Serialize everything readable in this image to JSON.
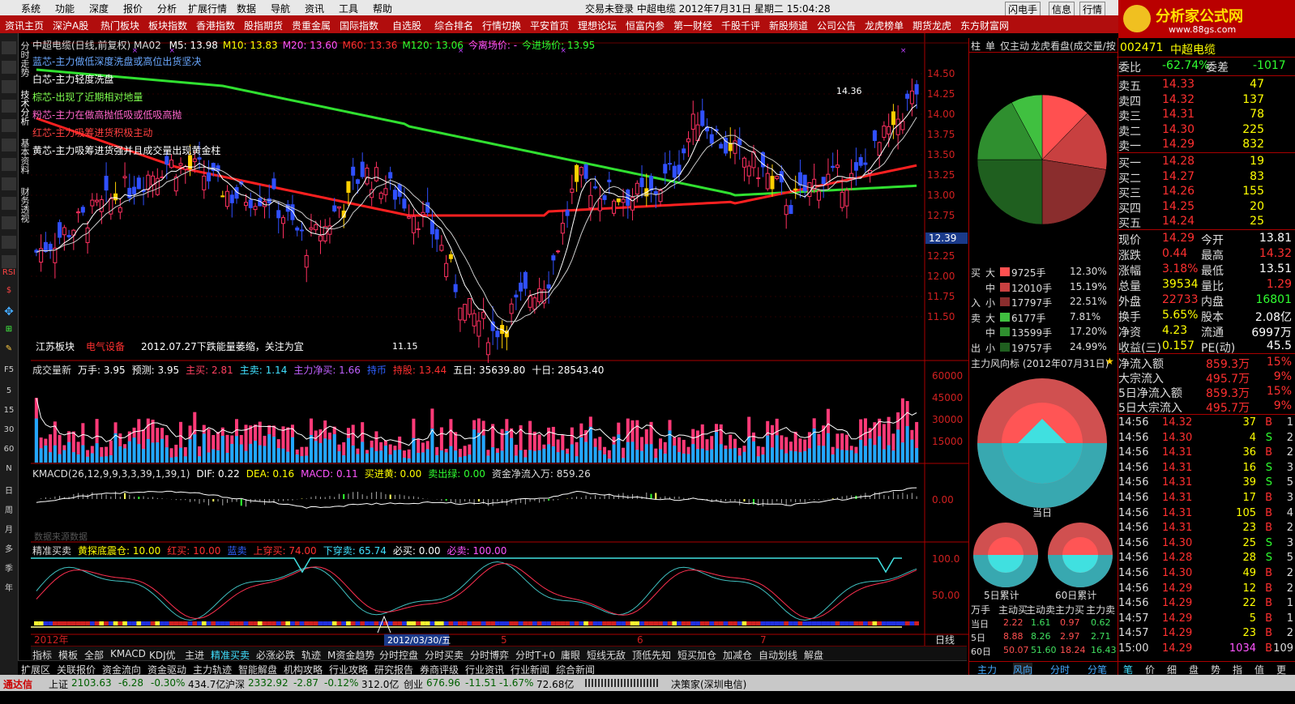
{
  "menubar": {
    "items": [
      "系统",
      "功能",
      "深度",
      "报价",
      "分析",
      "扩展行情",
      "数据",
      "导航",
      "资讯",
      "工具",
      "帮助"
    ],
    "center": "交易未登录   中超电缆  2012年7月31日  星期二  15:04:28",
    "right_buttons": [
      "闪电手",
      "信息",
      "行情"
    ]
  },
  "brand": {
    "logo": "分析家公式网",
    "url": "www.88gs.com"
  },
  "navbar": [
    "资讯主页",
    "深沪A股",
    "热门板块",
    "板块指数",
    "香港指数",
    "股指期货",
    "贵重金属",
    "国际指数",
    "自选股",
    "综合排名",
    "行情切换",
    "平安首页",
    "理想论坛",
    "恒富内参",
    "第一财经",
    "千股千评",
    "新股频道",
    "公司公告",
    "龙虎榜单",
    "期货龙虎",
    "东方财富网"
  ],
  "left_tools": [
    "分",
    "K",
    "技",
    "基",
    "财",
    "RSI",
    "$",
    "5",
    "15",
    "30",
    "60",
    "N",
    "日",
    "周",
    "月",
    "多",
    "季",
    "年"
  ],
  "vtabs": [
    "分时走势",
    "技术分析",
    "基本资料",
    "财务透视"
  ],
  "kchart": {
    "header": "中超电缆(日线,前复权) MA02",
    "ma": [
      {
        "label": "M5: 13.98",
        "color": "#ffffff"
      },
      {
        "label": "M10: 13.83",
        "color": "#ffff00"
      },
      {
        "label": "M20: 13.60",
        "color": "#ff55ff"
      },
      {
        "label": "M60: 13.36",
        "color": "#ff3030"
      },
      {
        "label": "M120: 13.06",
        "color": "#30ff30"
      },
      {
        "label": "今离场价: -",
        "color": "#ff55ff"
      },
      {
        "label": "今进场价: 13.95",
        "color": "#30ff30"
      }
    ],
    "notes": [
      {
        "text": "蓝芯-主力做低深度洗盘或高位出货坚决",
        "color": "#6aa8ff"
      },
      {
        "text": "白芯-主力轻度洗盘",
        "color": "#ffffff"
      },
      {
        "text": "棕芯-出现了近期相对地量",
        "color": "#7fff4f"
      },
      {
        "text": "粉芯-主力在做高抛低吸或低吸高抛",
        "color": "#ff66cc"
      },
      {
        "text": "红芯-主力吸筹进货积极主动",
        "color": "#ff4040"
      },
      {
        "text": "黄芯-主力吸筹进货强并且成交量出现黄金柱",
        "color": "#ffffff"
      }
    ],
    "price_axis": [
      "14.50",
      "14.25",
      "14.00",
      "13.75",
      "13.50",
      "13.25",
      "13.00",
      "12.75",
      "12.50",
      "12.25",
      "12.00",
      "11.75",
      "11.50"
    ],
    "current_price_tag": "12.39",
    "high_label": "14.36",
    "low_label": "11.15",
    "board": "江苏板块",
    "sector": "电气设备",
    "comment": "2012.07.27下跌能量萎缩，关注为宜"
  },
  "volpanel": {
    "header": [
      {
        "t": "成交量新",
        "c": "#dddddd"
      },
      {
        "t": "万手: 3.95",
        "c": "#ffffff"
      },
      {
        "t": "预测: 3.95",
        "c": "#ffffff"
      },
      {
        "t": "主买: 2.81",
        "c": "#ff4060"
      },
      {
        "t": "主卖: 1.14",
        "c": "#40e0ff"
      },
      {
        "t": "主力净买: 1.66",
        "c": "#c060ff"
      },
      {
        "t": "持币",
        "c": "#3060ff"
      },
      {
        "t": "持股: 13.44",
        "c": "#ff3030"
      },
      {
        "t": "五日: 35639.80",
        "c": "#ffffff"
      },
      {
        "t": "十日: 28543.40",
        "c": "#ffffff"
      }
    ],
    "axis": [
      "60000",
      "45000",
      "30000",
      "15000"
    ]
  },
  "macd": {
    "header": [
      {
        "t": "KMACD(26,12,9,9,3,3,39,1,39,1)",
        "c": "#dddddd"
      },
      {
        "t": "DIF: 0.22",
        "c": "#ffffff"
      },
      {
        "t": "DEA: 0.16",
        "c": "#ffff00"
      },
      {
        "t": "MACD: 0.11",
        "c": "#ff55ff"
      },
      {
        "t": "买进黄: 0.00",
        "c": "#ffff00"
      },
      {
        "t": "卖出绿: 0.00",
        "c": "#30ff30"
      },
      {
        "t": "资金净流入万: 859.26",
        "c": "#dddddd"
      }
    ],
    "axis": [
      "0.00"
    ],
    "watermark": "数据来源数据"
  },
  "precise": {
    "header": [
      {
        "t": "精准买卖",
        "c": "#dddddd"
      },
      {
        "t": "黄探底震仓: 10.00",
        "c": "#ffff00"
      },
      {
        "t": "红买: 10.00",
        "c": "#ff3030"
      },
      {
        "t": "蓝卖",
        "c": "#3060ff"
      },
      {
        "t": "上穿买: 74.00",
        "c": "#ff3030"
      },
      {
        "t": "下穿卖: 65.74",
        "c": "#40e0ff"
      },
      {
        "t": "必买: 0.00",
        "c": "#ffffff"
      },
      {
        "t": "必卖: 100.00",
        "c": "#ff55ff"
      }
    ],
    "axis": [
      "100.0",
      "50.00"
    ]
  },
  "timeline": {
    "year": "2012年",
    "date": "2012/03/30/五",
    "months": [
      "5",
      "6",
      "7"
    ],
    "period": "日线"
  },
  "bottom_tabs": [
    "指标",
    "模板",
    "全部",
    "KMACD",
    "KDJ优",
    "主进",
    "精准买卖",
    "必涨必跌",
    "轨迹",
    "M资金趋势",
    "分时控盘",
    "分时买卖",
    "分时博弈",
    "分时T+0",
    "庸眼",
    "短线无敌",
    "顶低先知",
    "短买加仓",
    "加减仓",
    "自动划线",
    "解盘"
  ],
  "bottom_tabs2": [
    "扩展区",
    "关联报价",
    "资金流向",
    "资金驱动",
    "主力轨迹",
    "智能解盘",
    "机构攻略",
    "行业攻略",
    "研究报告",
    "券商评级",
    "行业资讯",
    "行业新闻",
    "综合新闻"
  ],
  "rightmid": {
    "tabs": [
      "柱",
      "单",
      "仅主动",
      "龙虎看盘(成交量/按"
    ],
    "flow_rows": [
      {
        "side": "买",
        "size": "大",
        "val": "9725手",
        "pct": "12.30%",
        "color": "#ff5050"
      },
      {
        "side": "",
        "size": "中",
        "val": "12010手",
        "pct": "15.19%",
        "color": "#c84040"
      },
      {
        "side": "入",
        "size": "小",
        "val": "17797手",
        "pct": "22.51%",
        "color": "#8a2d2d"
      },
      {
        "side": "卖",
        "size": "大",
        "val": "6177手",
        "pct": "7.81%",
        "color": "#40c040"
      },
      {
        "side": "",
        "size": "中",
        "val": "13599手",
        "pct": "17.20%",
        "color": "#2f8f2f"
      },
      {
        "side": "出",
        "size": "小",
        "val": "19757手",
        "pct": "24.99%",
        "color": "#1f5f1f"
      }
    ],
    "wind_title": "主力风向标 (2012年07月31日)",
    "today_label": "当日",
    "day5_label": "5日累计",
    "day60_label": "60日累计",
    "table_header": [
      "万手",
      "主动买",
      "主动卖",
      "主力买",
      "主力卖"
    ],
    "table_rows": [
      [
        "当日",
        "2.22",
        "1.61",
        "0.97",
        "0.62"
      ],
      [
        "5日",
        "8.88",
        "8.26",
        "2.97",
        "2.71"
      ],
      [
        "60日",
        "50.07",
        "51.60",
        "18.24",
        "16.43"
      ]
    ],
    "bottom_tabs": [
      "主力",
      "风向",
      "分时",
      "分笔"
    ]
  },
  "quote": {
    "code": "002471",
    "name": "中超电缆",
    "weibi": {
      "label": "委比",
      "val": "-62.74%",
      "label2": "委差",
      "val2": "-1017"
    },
    "asks": [
      {
        "l": "卖五",
        "p": "14.33",
        "v": "47"
      },
      {
        "l": "卖四",
        "p": "14.32",
        "v": "137"
      },
      {
        "l": "卖三",
        "p": "14.31",
        "v": "78"
      },
      {
        "l": "卖二",
        "p": "14.30",
        "v": "225"
      },
      {
        "l": "卖一",
        "p": "14.29",
        "v": "832"
      }
    ],
    "bids": [
      {
        "l": "买一",
        "p": "14.28",
        "v": "19"
      },
      {
        "l": "买二",
        "p": "14.27",
        "v": "83"
      },
      {
        "l": "买三",
        "p": "14.26",
        "v": "155"
      },
      {
        "l": "买四",
        "p": "14.25",
        "v": "20"
      },
      {
        "l": "买五",
        "p": "14.24",
        "v": "25"
      }
    ],
    "stats": [
      {
        "l": "现价",
        "v": "14.29",
        "c": "#ff3030",
        "l2": "今开",
        "v2": "13.81",
        "c2": "#ffffff"
      },
      {
        "l": "涨跌",
        "v": "0.44",
        "c": "#ff3030",
        "l2": "最高",
        "v2": "14.32",
        "c2": "#ff3030"
      },
      {
        "l": "涨幅",
        "v": "3.18%",
        "c": "#ff3030",
        "l2": "最低",
        "v2": "13.51",
        "c2": "#ffffff"
      },
      {
        "l": "总量",
        "v": "39534",
        "c": "#ffff00",
        "l2": "量比",
        "v2": "1.29",
        "c2": "#ff3030"
      },
      {
        "l": "外盘",
        "v": "22733",
        "c": "#ff3030",
        "l2": "内盘",
        "v2": "16801",
        "c2": "#30ff30"
      },
      {
        "l": "换手",
        "v": "5.65%",
        "c": "#ffff00",
        "l2": "股本",
        "v2": "2.08亿",
        "c2": "#ffffff"
      },
      {
        "l": "净资",
        "v": "4.23",
        "c": "#ffff00",
        "l2": "流通",
        "v2": "6997万",
        "c2": "#ffffff"
      },
      {
        "l": "收益(三)",
        "v": "0.157",
        "c": "#ffff00",
        "l2": "PE(动)",
        "v2": "45.5",
        "c2": "#ffffff"
      }
    ],
    "flows": [
      {
        "l": "净流入额",
        "v": "859.3万",
        "p": "15%"
      },
      {
        "l": "大宗流入",
        "v": "495.7万",
        "p": "9%"
      },
      {
        "l": "5日净流入额",
        "v": "859.3万",
        "p": "15%"
      },
      {
        "l": "5日大宗流入",
        "v": "495.7万",
        "p": "9%"
      }
    ],
    "ticks": [
      [
        "14:56",
        "14.32",
        "37",
        "B",
        "1"
      ],
      [
        "14:56",
        "14.30",
        "4",
        "S",
        "2"
      ],
      [
        "14:56",
        "14.31",
        "36",
        "B",
        "2"
      ],
      [
        "14:56",
        "14.31",
        "16",
        "S",
        "3"
      ],
      [
        "14:56",
        "14.31",
        "39",
        "S",
        "5"
      ],
      [
        "14:56",
        "14.31",
        "17",
        "B",
        "3"
      ],
      [
        "14:56",
        "14.31",
        "105",
        "B",
        "4"
      ],
      [
        "14:56",
        "14.31",
        "23",
        "B",
        "2"
      ],
      [
        "14:56",
        "14.30",
        "25",
        "S",
        "3"
      ],
      [
        "14:56",
        "14.28",
        "28",
        "S",
        "5"
      ],
      [
        "14:56",
        "14.30",
        "49",
        "B",
        "2"
      ],
      [
        "14:56",
        "14.29",
        "12",
        "B",
        "2"
      ],
      [
        "14:56",
        "14.29",
        "22",
        "B",
        "1"
      ],
      [
        "14:57",
        "14.29",
        "5",
        "B",
        "1"
      ],
      [
        "14:57",
        "14.29",
        "23",
        "B",
        "2"
      ],
      [
        "15:00",
        "14.29",
        "1034",
        "B",
        "109"
      ]
    ],
    "bottom_tabs": [
      "笔",
      "价",
      "细",
      "盘",
      "势",
      "指",
      "值",
      "更"
    ]
  },
  "statusbar": {
    "brand": "通达信",
    "sh_label": "上证",
    "sh_val": "2103.63",
    "sh_chg": "-6.28",
    "sh_pct": "-0.30%",
    "sh_amt": "434.7亿",
    "sz_label": "沪深",
    "sz_val": "2332.92",
    "sz_chg": "-2.87",
    "sz_pct": "-0.12%",
    "sz_amt": "312.0亿",
    "cy_label": "创业",
    "cy_val": "676.96",
    "cy_chg": "-11.51",
    "cy_pct": "-1.67%",
    "cy_amt": "72.68亿",
    "right": "决策家(深圳电信)"
  }
}
